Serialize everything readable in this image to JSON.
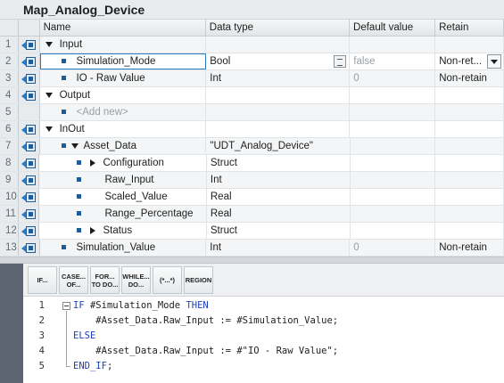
{
  "block_title": "Map_Analog_Device",
  "columns": {
    "name": "Name",
    "data_type": "Data type",
    "default_value": "Default value",
    "retain": "Retain"
  },
  "rows": [
    {
      "num": "1",
      "name": "Input",
      "type": "",
      "default": "",
      "retain": ""
    },
    {
      "num": "2",
      "name": "Simulation_Mode",
      "type": "Bool",
      "default": "false",
      "retain": "Non-ret..."
    },
    {
      "num": "3",
      "name": "IO - Raw Value",
      "type": "Int",
      "default": "0",
      "retain": "Non-retain"
    },
    {
      "num": "4",
      "name": "Output",
      "type": "",
      "default": "",
      "retain": ""
    },
    {
      "num": "5",
      "name": "<Add new>",
      "type": "",
      "default": "",
      "retain": ""
    },
    {
      "num": "6",
      "name": "InOut",
      "type": "",
      "default": "",
      "retain": ""
    },
    {
      "num": "7",
      "name": "Asset_Data",
      "type": "\"UDT_Analog_Device\"",
      "default": "",
      "retain": ""
    },
    {
      "num": "8",
      "name": "Configuration",
      "type": "Struct",
      "default": "",
      "retain": ""
    },
    {
      "num": "9",
      "name": "Raw_Input",
      "type": "Int",
      "default": "",
      "retain": ""
    },
    {
      "num": "10",
      "name": "Scaled_Value",
      "type": "Real",
      "default": "",
      "retain": ""
    },
    {
      "num": "11",
      "name": "Range_Percentage",
      "type": "Real",
      "default": "",
      "retain": ""
    },
    {
      "num": "12",
      "name": "Status",
      "type": "Struct",
      "default": "",
      "retain": ""
    },
    {
      "num": "13",
      "name": "Simulation_Value",
      "type": "Int",
      "default": "0",
      "retain": "Non-retain"
    }
  ],
  "toolbar": {
    "if": "IF...",
    "case": "CASE...\nOF...",
    "for": "FOR...\nTO DO...",
    "while": "WHILE...\nDO...",
    "comment": "(*...*)",
    "region": "REGION"
  },
  "code": {
    "line_numbers": [
      "1",
      "2",
      "3",
      "4",
      "5"
    ],
    "l1_kw1": "IF",
    "l1_mid": " #Simulation_Mode ",
    "l1_kw2": "THEN",
    "l2": "    #Asset_Data.Raw_Input := #Simulation_Value;",
    "l3_kw": "ELSE",
    "l4": "    #Asset_Data.Raw_Input := #\"IO - Raw Value\";",
    "l5_kw": "END_IF",
    "l5_end": ";"
  },
  "icons": {
    "interface_row": "io-interface-icon",
    "expand": "expand-arrow-icon",
    "collapse": "collapse-arrow-icon"
  },
  "colors": {
    "keyword": "#1d3fbf",
    "icon_blue": "#1d5e9a",
    "selection": "#2a7cc7"
  }
}
